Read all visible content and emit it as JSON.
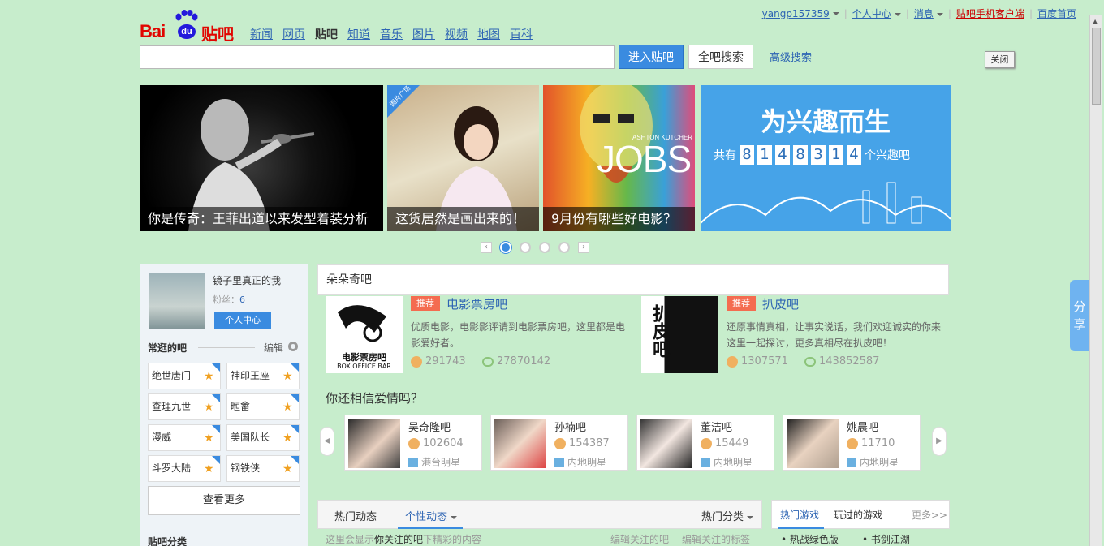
{
  "topbar": {
    "username": "yangp157359",
    "personal_center": "个人中心",
    "messages": "消息",
    "mobile_client": "贴吧手机客户端",
    "baidu_home": "百度首页"
  },
  "logo": {
    "bai": "Bai",
    "du": "du",
    "tieba": "贴吧"
  },
  "nav": [
    "新闻",
    "网页",
    "贴吧",
    "知道",
    "音乐",
    "图片",
    "视频",
    "地图",
    "百科"
  ],
  "search": {
    "value": "",
    "enter_button": "进入贴吧",
    "search_all_button": "全吧搜索",
    "advanced": "高级搜索"
  },
  "close_label": "关闭",
  "banners": [
    {
      "caption": "你是传奇：王菲出道以来发型着装分析"
    },
    {
      "caption": "这货居然是画出来的！",
      "ribbon": "图片广场"
    },
    {
      "caption": "9月份有哪些好电影？",
      "poster_text": "JOBS",
      "poster_sub": "ASHTON KUTCHER"
    },
    {
      "title": "为兴趣而生",
      "prefix": "共有",
      "digits": [
        "8",
        "1",
        "4",
        "8",
        "3",
        "1",
        "4"
      ],
      "suffix": "个兴趣吧"
    }
  ],
  "user": {
    "name": "镜子里真正的我",
    "fans_label": "粉丝：",
    "fans_count": "6",
    "center_button": "个人中心"
  },
  "frequent": {
    "heading": "常逛的吧",
    "edit": "编辑",
    "bars": [
      "绝世唐门",
      "神印王座",
      "查理九世",
      "暅畬",
      "漫威",
      "美国队长",
      "斗罗大陆",
      "钢铁侠"
    ],
    "more_button": "查看更多",
    "category_heading": "贴吧分类"
  },
  "center": {
    "header": "朵朵奇吧",
    "featured": [
      {
        "tag": "推荐",
        "title": "电影票房吧",
        "desc": "优质电影，电影影评请到电影票房吧，这里都是电影爱好者。",
        "members": "291743",
        "posts": "27870142",
        "img_text": "电影票房吧",
        "img_sub": "BOX OFFICE BAR"
      },
      {
        "tag": "推荐",
        "title": "扒皮吧",
        "desc": "还原事情真相，让事实说话，我们欢迎诚实的你来这里一起探讨，更多真相尽在扒皮吧！",
        "members": "1307571",
        "posts": "143852587",
        "img_text": "扒皮吧"
      }
    ],
    "section_title": "你还相信爱情吗？",
    "cards": [
      {
        "name": "吴奇隆吧",
        "count": "102604",
        "category": "港台明星"
      },
      {
        "name": "孙楠吧",
        "count": "154387",
        "category": "内地明星"
      },
      {
        "name": "董洁吧",
        "count": "15449",
        "category": "内地明星"
      },
      {
        "name": "姚晨吧",
        "count": "11710",
        "category": "内地明星"
      }
    ]
  },
  "bottom_tabs": {
    "hot": "热门动态",
    "personal": "个性动态",
    "hot_category": "热门分类",
    "hint_prefix": "这里会显示",
    "hint_bold": "你关注的吧",
    "hint_suffix": "下精彩的内容",
    "edit_followed": "编辑关注的吧",
    "edit_tags": "编辑关注的标签"
  },
  "games": {
    "hot": "热门游戏",
    "played": "玩过的游戏",
    "more": "更多>>",
    "items": [
      "热战绿色版",
      "书剑江湖"
    ]
  },
  "share": [
    "分",
    "享"
  ]
}
